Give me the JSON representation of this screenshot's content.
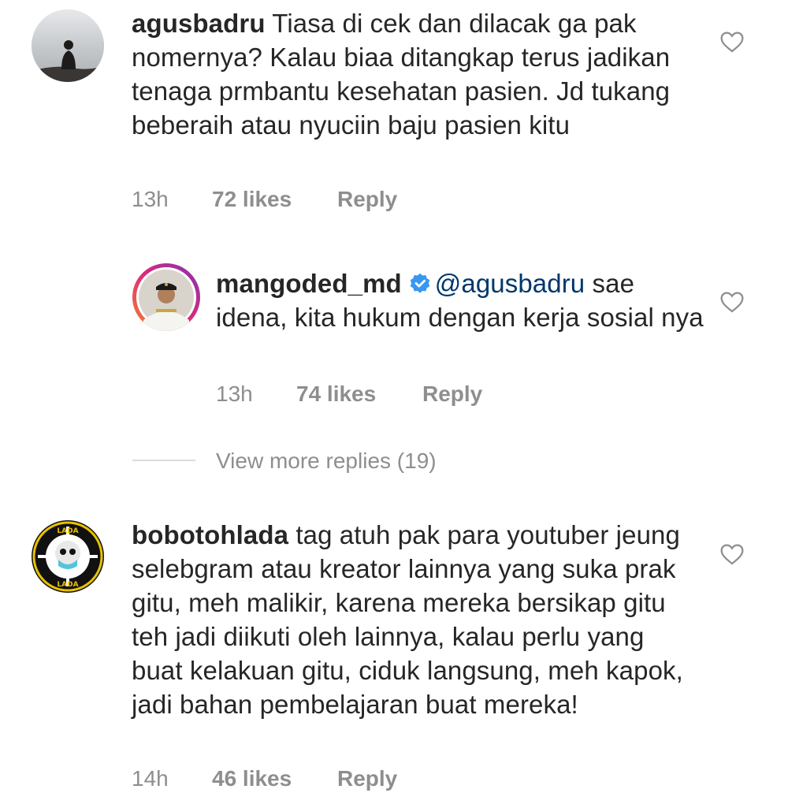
{
  "comments": [
    {
      "username": "agusbadru",
      "text": "Tiasa di cek dan dilacak ga pak nomernya? Kalau biaa ditangkap terus jadikan tenaga prmbantu kesehatan pasien. Jd tukang beberaih atau nyuciin baju pasien kitu",
      "time": "13h",
      "likes": "72 likes",
      "reply_label": "Reply",
      "avatar_icon": "person-silhouette-icon"
    },
    {
      "username": "mangoded_md",
      "verified": true,
      "mention": "@agusbadru",
      "text": "sae idena, kita hukum dengan kerja sosial nya",
      "time": "13h",
      "likes": "74 likes",
      "reply_label": "Reply",
      "avatar_icon": "official-portrait-icon"
    },
    {
      "username": "bobotohlada",
      "text": "tag atuh pak para youtuber jeung selebgram atau kreator lainnya yang suka prak gitu, meh malikir, karena mereka bersikap gitu teh jadi diikuti oleh lainnya, kalau perlu yang buat kelakuan gitu, ciduk langsung, meh kapok, jadi bahan pembelajaran buat mereka!",
      "time": "14h",
      "likes": "46 likes",
      "reply_label": "Reply",
      "avatar_icon": "lada-skull-logo-icon"
    }
  ],
  "view_more": "View more replies (19)",
  "colors": {
    "text": "#262626",
    "secondary": "#8e8e8e",
    "mention": "#00376b",
    "verified": "#3897f0"
  }
}
